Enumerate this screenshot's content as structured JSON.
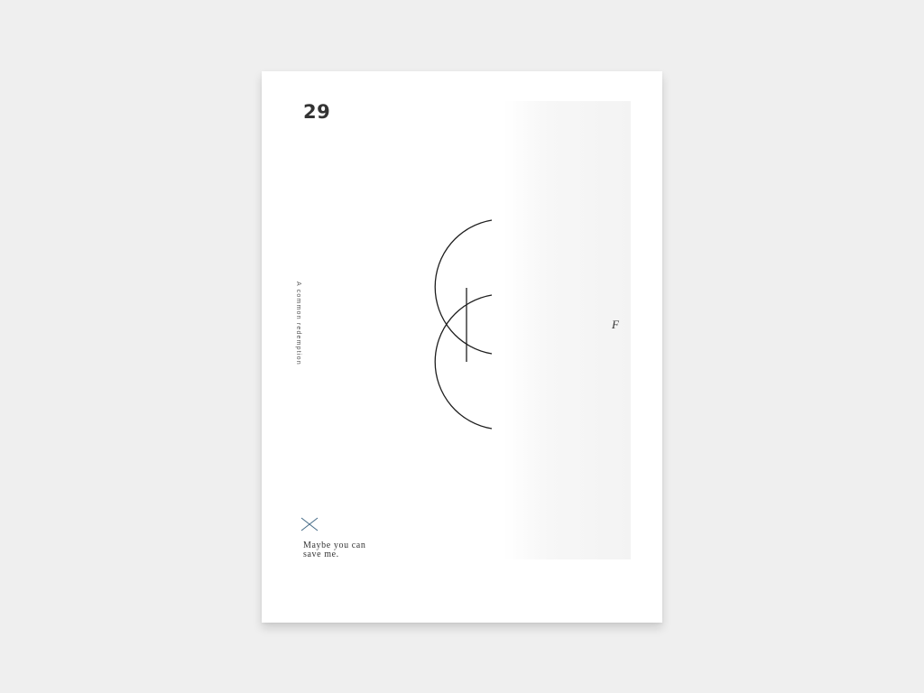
{
  "poster": {
    "number": "29",
    "vertical_caption": "A common redemption",
    "side_letter": "F",
    "quote_lines": [
      "Maybe you can",
      "save me."
    ],
    "icons": {
      "emblem": "double-crescent-icon",
      "mark": "cross-icon"
    },
    "colors": {
      "background": "#efefef",
      "card": "#ffffff",
      "ink": "#333333",
      "accent": "#4a6f8a"
    }
  }
}
